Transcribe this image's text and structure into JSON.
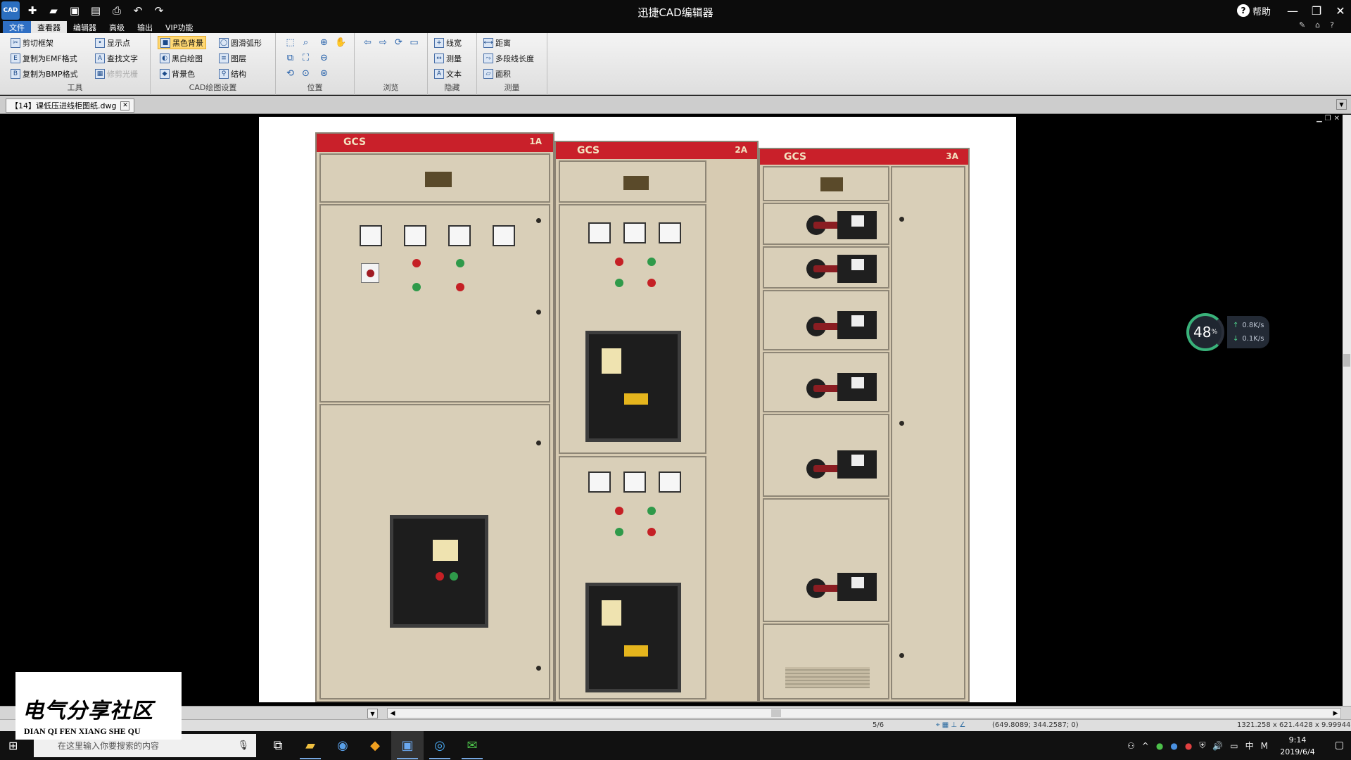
{
  "app": {
    "title": "迅捷CAD编辑器",
    "logo": "CAD",
    "help": "帮助"
  },
  "menu": [
    "文件",
    "查看器",
    "编辑器",
    "高级",
    "输出",
    "VIP功能"
  ],
  "ribbon": {
    "tools": {
      "label": "工具",
      "items": [
        "剪切框架",
        "复制为EMF格式",
        "复制为BMP格式",
        "显示点",
        "查找文字",
        "修剪光栅"
      ]
    },
    "cad_settings": {
      "label": "CAD绘图设置",
      "items": [
        "黑色背景",
        "黑白绘图",
        "背景色",
        "圆滑弧形",
        "图层",
        "结构"
      ]
    },
    "position": {
      "label": "位置"
    },
    "browse": {
      "label": "浏览"
    },
    "hide": {
      "label": "隐藏",
      "items": [
        "线宽",
        "测量",
        "文本"
      ]
    },
    "measure": {
      "label": "测量",
      "items": [
        "距离",
        "多段线长度",
        "面积"
      ]
    }
  },
  "document_tab": "【14】课低压进线柜图纸.dwg",
  "cabinets": {
    "label1": "GCS",
    "num1": "1A",
    "label2": "GCS",
    "num2": "2A",
    "label3": "GCS",
    "num3": "3A"
  },
  "net_monitor": {
    "percent": "48",
    "percent_unit": "%",
    "up": "0.8",
    "down": "0.1",
    "rate_unit": "K/s"
  },
  "status": {
    "page": "5/6",
    "coords": "(649.8089; 344.2587; 0)",
    "extent": "1321.258 x 621.4428 x 9.999446"
  },
  "taskbar": {
    "search_placeholder": "在这里输入你要搜索的内容",
    "time": "9:14",
    "date": "2019/6/4",
    "ime": "中"
  },
  "watermark": {
    "cn": "电气分享社区",
    "en": "DIAN QI FEN XIANG SHE QU"
  },
  "colors": {
    "file_menu": "#2f6fc4",
    "cabinet_red": "#c9202a",
    "cabinet_body": "#d7cbb2"
  }
}
